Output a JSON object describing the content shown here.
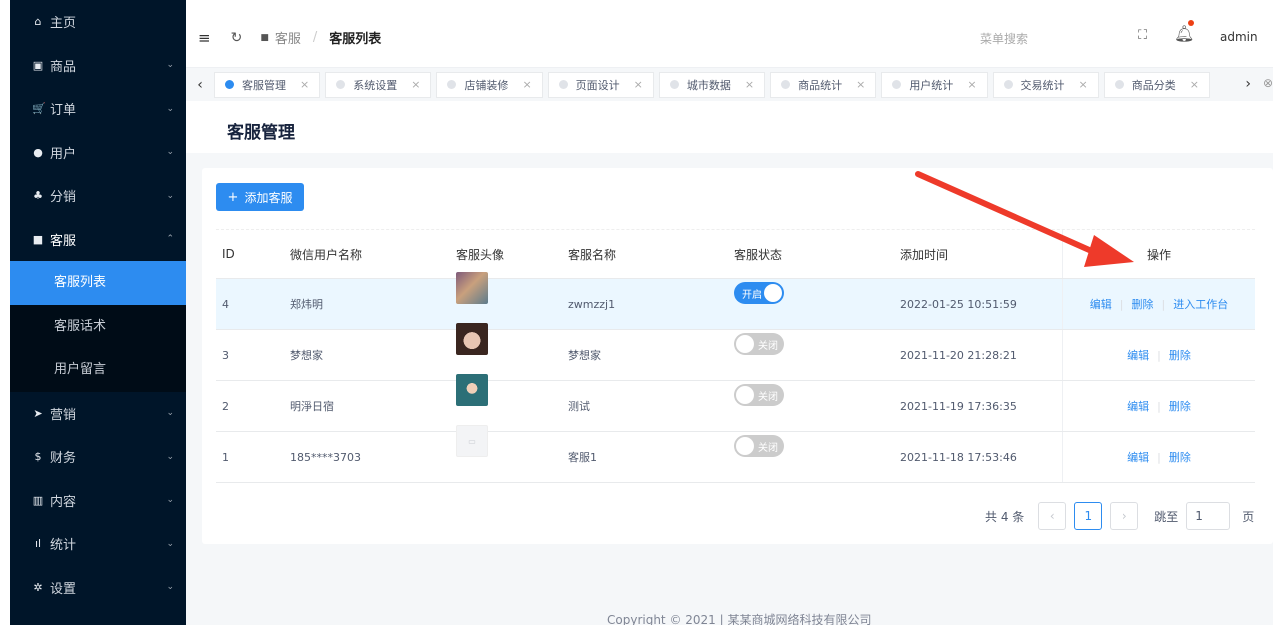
{
  "sidebar": {
    "items": [
      {
        "label": "主页",
        "icon": "home-icon",
        "glyph": "⌂",
        "chevron": ""
      },
      {
        "label": "商品",
        "icon": "shop-icon",
        "glyph": "▣",
        "chevron": "⌄"
      },
      {
        "label": "订单",
        "icon": "cart-icon",
        "glyph": "🛒",
        "chevron": "⌄"
      },
      {
        "label": "用户",
        "icon": "user-icon",
        "glyph": "●",
        "chevron": "⌄"
      },
      {
        "label": "分销",
        "icon": "distribution-icon",
        "glyph": "♣",
        "chevron": "⌄"
      },
      {
        "label": "客服",
        "icon": "chat-icon",
        "glyph": "■",
        "chevron": "⌃"
      }
    ],
    "submenu": [
      "客服列表",
      "客服话术",
      "用户留言"
    ],
    "items_after": [
      {
        "label": "营销",
        "icon": "send-icon",
        "glyph": "➤",
        "chevron": "⌄"
      },
      {
        "label": "财务",
        "icon": "dollar-icon",
        "glyph": "$",
        "chevron": "⌄"
      },
      {
        "label": "内容",
        "icon": "book-icon",
        "glyph": "▥",
        "chevron": "⌄"
      },
      {
        "label": "统计",
        "icon": "bar-chart-icon",
        "glyph": "ıl",
        "chevron": "⌄"
      },
      {
        "label": "设置",
        "icon": "gear-icon",
        "glyph": "✲",
        "chevron": "⌄"
      }
    ]
  },
  "header": {
    "crumb1": "客服",
    "crumb2": "客服列表",
    "search_placeholder": "菜单搜索",
    "user": "admin"
  },
  "tabs": [
    {
      "label": "客服管理",
      "active": true
    },
    {
      "label": "系统设置",
      "active": false
    },
    {
      "label": "店铺装修",
      "active": false
    },
    {
      "label": "页面设计",
      "active": false
    },
    {
      "label": "城市数据",
      "active": false
    },
    {
      "label": "商品统计",
      "active": false
    },
    {
      "label": "用户统计",
      "active": false
    },
    {
      "label": "交易统计",
      "active": false
    },
    {
      "label": "商品分类",
      "active": false
    }
  ],
  "page": {
    "title": "客服管理",
    "add_button": "添加客服"
  },
  "table": {
    "columns": [
      "ID",
      "微信用户名称",
      "客服头像",
      "客服名称",
      "客服状态",
      "添加时间",
      "操作"
    ],
    "rows": [
      {
        "id": "4",
        "wechat_name": "郑炜明",
        "avatar": "av1",
        "name": "zwmzzj1",
        "status": "开启",
        "on": true,
        "time": "2022-01-25 10:51:59",
        "actions": [
          "编辑",
          "删除",
          "进入工作台"
        ]
      },
      {
        "id": "3",
        "wechat_name": "梦想家",
        "avatar": "av2",
        "name": "梦想家",
        "status": "关闭",
        "on": false,
        "time": "2021-11-20 21:28:21",
        "actions": [
          "编辑",
          "删除"
        ]
      },
      {
        "id": "2",
        "wechat_name": "明淨日宿",
        "avatar": "av3",
        "name": "测试",
        "status": "关闭",
        "on": false,
        "time": "2021-11-19 17:36:35",
        "actions": [
          "编辑",
          "删除"
        ]
      },
      {
        "id": "1",
        "wechat_name": "185****3703",
        "avatar": "av4",
        "name": "客服1",
        "status": "关闭",
        "on": false,
        "time": "2021-11-18 17:53:46",
        "actions": [
          "编辑",
          "删除"
        ]
      }
    ]
  },
  "pagination": {
    "total": "共 4 条",
    "current": "1",
    "jump_label": "跳至",
    "jump_value": "1",
    "page_suffix": "页"
  },
  "footer": {
    "copyright": "Copyright © 2021 | 某某商城网络科技有限公司"
  },
  "colors": {
    "sidebar_bg": "#001529",
    "primary": "#2d8cf0",
    "annotation_arrow": "#ee3a2a"
  }
}
